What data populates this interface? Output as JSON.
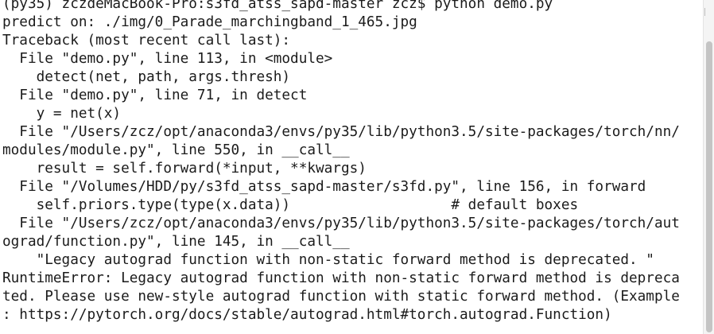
{
  "terminal": {
    "lines": [
      "(py35) zczdeMacBook-Pro:s3fd_atss_sapd-master zcz$ python demo.py",
      "predict on: ./img/0_Parade_marchingband_1_465.jpg",
      "Traceback (most recent call last):",
      "  File \"demo.py\", line 113, in <module>",
      "    detect(net, path, args.thresh)",
      "  File \"demo.py\", line 71, in detect",
      "    y = net(x)",
      "  File \"/Users/zcz/opt/anaconda3/envs/py35/lib/python3.5/site-packages/torch/nn/",
      "modules/module.py\", line 550, in __call__",
      "    result = self.forward(*input, **kwargs)",
      "  File \"/Volumes/HDD/py/s3fd_atss_sapd-master/s3fd.py\", line 156, in forward",
      "    self.priors.type(type(x.data))                   # default boxes",
      "  File \"/Users/zcz/opt/anaconda3/envs/py35/lib/python3.5/site-packages/torch/aut",
      "ograd/function.py\", line 145, in __call__",
      "    \"Legacy autograd function with non-static forward method is deprecated. \"",
      "RuntimeError: Legacy autograd function with non-static forward method is depreca",
      "ted. Please use new-style autograd function with static forward method. (Example",
      ": https://pytorch.org/docs/stable/autograd.html#torch.autograd.Function)"
    ]
  }
}
